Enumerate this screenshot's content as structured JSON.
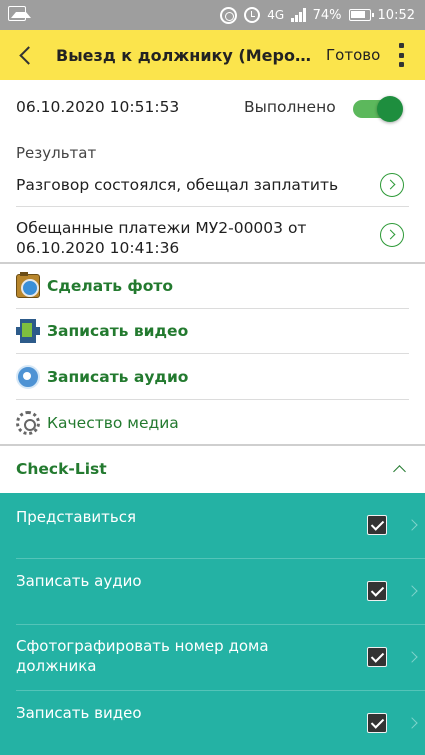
{
  "status_bar": {
    "network": "4G",
    "battery": "74%",
    "time": "10:52"
  },
  "header": {
    "title": "Выезд к должнику (Мероприятие)",
    "done_label": "Готово"
  },
  "details": {
    "datetime": "06.10.2020 10:51:53",
    "status_label": "Выполнено",
    "completed": true,
    "result_label": "Результат",
    "result_value": "Разговор состоялся, обещал заплатить",
    "payment_value": "Обещанные платежи МУ2-00003 от 06.10.2020 10:41:36"
  },
  "actions": [
    {
      "label": "Сделать фото",
      "icon": "camera-icon"
    },
    {
      "label": "Записать видео",
      "icon": "film-icon"
    },
    {
      "label": "Записать аудио",
      "icon": "audio-icon"
    },
    {
      "label": "Качество медиа",
      "icon": "gear-icon"
    }
  ],
  "checklist": {
    "title": "Check-List",
    "items": [
      {
        "label": "Представиться",
        "checked": true
      },
      {
        "label": "Записать аудио",
        "checked": true
      },
      {
        "label": "Сфотографировать номер дома должника",
        "checked": true
      },
      {
        "label": "Записать видео",
        "checked": true
      }
    ]
  },
  "colors": {
    "header": "#fbe44c",
    "accent_green": "#237a2f",
    "checklist_bg": "#24b2a4",
    "switch_on": "#1e8e3e"
  }
}
